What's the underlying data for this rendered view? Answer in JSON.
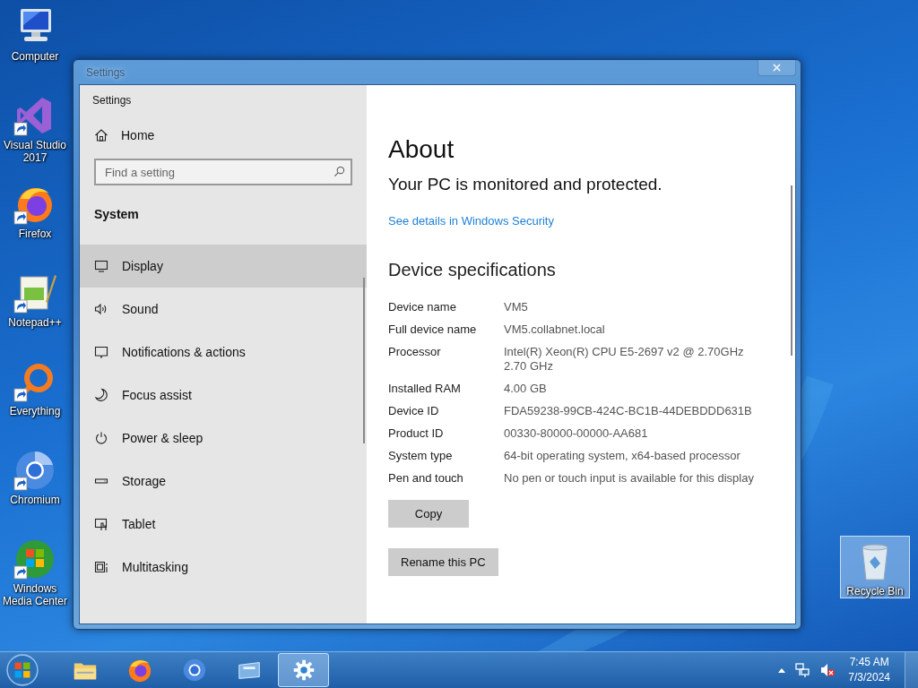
{
  "desktop_icons": [
    {
      "label": "Computer",
      "kind": "computer",
      "shortcut": false
    },
    {
      "label": "Visual Studio 2017",
      "kind": "vs",
      "shortcut": true
    },
    {
      "label": "Firefox",
      "kind": "firefox",
      "shortcut": true
    },
    {
      "label": "Notepad++",
      "kind": "notepad",
      "shortcut": true
    },
    {
      "label": "Everything",
      "kind": "everything",
      "shortcut": true
    },
    {
      "label": "Chromium",
      "kind": "chromium",
      "shortcut": true
    },
    {
      "label": "Windows Media Center",
      "kind": "wmc",
      "shortcut": true
    }
  ],
  "recycle_bin": {
    "label": "Recycle Bin",
    "selected": true
  },
  "window": {
    "title": "Settings"
  },
  "sidebar": {
    "app_title": "Settings",
    "home": "Home",
    "search": {
      "placeholder": "Find a setting"
    },
    "section": "System",
    "items": [
      {
        "label": "Display",
        "kind": "display",
        "selected": true
      },
      {
        "label": "Sound",
        "kind": "sound",
        "selected": false
      },
      {
        "label": "Notifications & actions",
        "kind": "notifications",
        "selected": false
      },
      {
        "label": "Focus assist",
        "kind": "focus",
        "selected": false
      },
      {
        "label": "Power & sleep",
        "kind": "power",
        "selected": false
      },
      {
        "label": "Storage",
        "kind": "storage",
        "selected": false
      },
      {
        "label": "Tablet",
        "kind": "tablet",
        "selected": false
      },
      {
        "label": "Multitasking",
        "kind": "multitasking",
        "selected": false
      }
    ]
  },
  "content": {
    "title": "About",
    "status": "Your PC is monitored and protected.",
    "link": "See details in Windows Security",
    "specs_title": "Device specifications",
    "specs": [
      {
        "label": "Device name",
        "value": "VM5"
      },
      {
        "label": "Full device name",
        "value": "VM5.collabnet.local"
      },
      {
        "label": "Processor",
        "value": "Intel(R) Xeon(R) CPU E5-2697 v2 @ 2.70GHz\n2.70 GHz"
      },
      {
        "label": "Installed RAM",
        "value": "4.00 GB"
      },
      {
        "label": "Device ID",
        "value": "FDA59238-99CB-424C-BC1B-44DEBDDD631B"
      },
      {
        "label": "Product ID",
        "value": "00330-80000-00000-AA681"
      },
      {
        "label": "System type",
        "value": "64-bit operating system, x64-based processor"
      },
      {
        "label": "Pen and touch",
        "value": "No pen or touch input is available for this display"
      }
    ],
    "buttons": [
      {
        "label": "Copy"
      },
      {
        "label": "Rename this PC"
      }
    ]
  },
  "taskbar": {
    "items": [
      {
        "kind": "explorer",
        "selected": false
      },
      {
        "kind": "firefox",
        "selected": false
      },
      {
        "kind": "chromium",
        "selected": false
      },
      {
        "kind": "window",
        "selected": false
      },
      {
        "kind": "settings",
        "selected": true
      }
    ],
    "time": "7:45 AM",
    "date": "7/3/2024"
  }
}
